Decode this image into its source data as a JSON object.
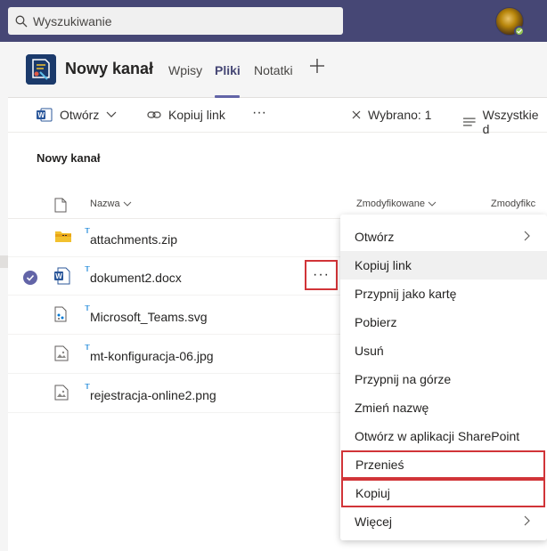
{
  "search": {
    "placeholder": "Wyszukiwanie"
  },
  "channel": {
    "name": "Nowy kanał",
    "tabs": [
      {
        "label": "Wpisy"
      },
      {
        "label": "Pliki"
      },
      {
        "label": "Notatki"
      }
    ],
    "active_tab": "Pliki"
  },
  "toolbar": {
    "open_label": "Otwórz",
    "copy_link_label": "Kopiuj link",
    "more_label": "···",
    "selected_label": "Wybrano: 1",
    "all_label": "Wszystkie d"
  },
  "section_title": "Nowy kanał",
  "columns": {
    "name": "Nazwa",
    "modified": "Zmodyfikowane",
    "modified_by": "Zmodyfikc"
  },
  "files": [
    {
      "name": "attachments.zip",
      "icon": "zip-folder-icon"
    },
    {
      "name": "dokument2.docx",
      "icon": "word-doc-icon"
    },
    {
      "name": "Microsoft_Teams.svg",
      "icon": "svg-file-icon"
    },
    {
      "name": "mt-konfiguracja-06.jpg",
      "icon": "image-file-icon"
    },
    {
      "name": "rejestracja-online2.png",
      "icon": "image-file-icon"
    }
  ],
  "row_more_label": "···",
  "context_menu": [
    {
      "label": "Otwórz",
      "submenu": true
    },
    {
      "label": "Kopiuj link"
    },
    {
      "label": "Przypnij jako kartę"
    },
    {
      "label": "Pobierz"
    },
    {
      "label": "Usuń"
    },
    {
      "label": "Przypnij na górze"
    },
    {
      "label": "Zmień nazwę"
    },
    {
      "label": "Otwórz w aplikacji SharePoint"
    },
    {
      "label": "Przenieś"
    },
    {
      "label": "Kopiuj"
    },
    {
      "label": "Więcej",
      "submenu": true
    }
  ],
  "colors": {
    "header": "#464775",
    "accent": "#6264a7",
    "highlight": "#d13438"
  }
}
